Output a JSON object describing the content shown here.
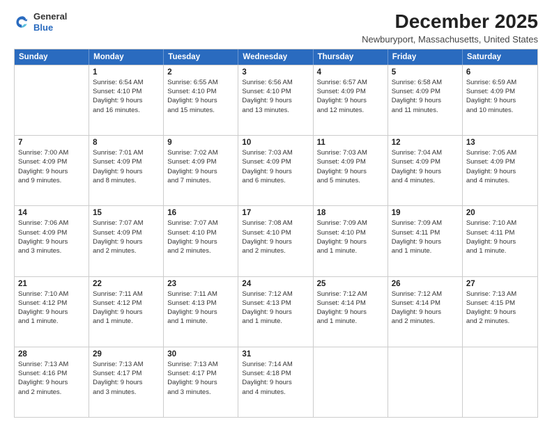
{
  "header": {
    "logo_general": "General",
    "logo_blue": "Blue",
    "month_title": "December 2025",
    "location": "Newburyport, Massachusetts, United States"
  },
  "weekdays": [
    "Sunday",
    "Monday",
    "Tuesday",
    "Wednesday",
    "Thursday",
    "Friday",
    "Saturday"
  ],
  "rows": [
    [
      {
        "day": "",
        "info": ""
      },
      {
        "day": "1",
        "info": "Sunrise: 6:54 AM\nSunset: 4:10 PM\nDaylight: 9 hours\nand 16 minutes."
      },
      {
        "day": "2",
        "info": "Sunrise: 6:55 AM\nSunset: 4:10 PM\nDaylight: 9 hours\nand 15 minutes."
      },
      {
        "day": "3",
        "info": "Sunrise: 6:56 AM\nSunset: 4:10 PM\nDaylight: 9 hours\nand 13 minutes."
      },
      {
        "day": "4",
        "info": "Sunrise: 6:57 AM\nSunset: 4:09 PM\nDaylight: 9 hours\nand 12 minutes."
      },
      {
        "day": "5",
        "info": "Sunrise: 6:58 AM\nSunset: 4:09 PM\nDaylight: 9 hours\nand 11 minutes."
      },
      {
        "day": "6",
        "info": "Sunrise: 6:59 AM\nSunset: 4:09 PM\nDaylight: 9 hours\nand 10 minutes."
      }
    ],
    [
      {
        "day": "7",
        "info": "Sunrise: 7:00 AM\nSunset: 4:09 PM\nDaylight: 9 hours\nand 9 minutes."
      },
      {
        "day": "8",
        "info": "Sunrise: 7:01 AM\nSunset: 4:09 PM\nDaylight: 9 hours\nand 8 minutes."
      },
      {
        "day": "9",
        "info": "Sunrise: 7:02 AM\nSunset: 4:09 PM\nDaylight: 9 hours\nand 7 minutes."
      },
      {
        "day": "10",
        "info": "Sunrise: 7:03 AM\nSunset: 4:09 PM\nDaylight: 9 hours\nand 6 minutes."
      },
      {
        "day": "11",
        "info": "Sunrise: 7:03 AM\nSunset: 4:09 PM\nDaylight: 9 hours\nand 5 minutes."
      },
      {
        "day": "12",
        "info": "Sunrise: 7:04 AM\nSunset: 4:09 PM\nDaylight: 9 hours\nand 4 minutes."
      },
      {
        "day": "13",
        "info": "Sunrise: 7:05 AM\nSunset: 4:09 PM\nDaylight: 9 hours\nand 4 minutes."
      }
    ],
    [
      {
        "day": "14",
        "info": "Sunrise: 7:06 AM\nSunset: 4:09 PM\nDaylight: 9 hours\nand 3 minutes."
      },
      {
        "day": "15",
        "info": "Sunrise: 7:07 AM\nSunset: 4:09 PM\nDaylight: 9 hours\nand 2 minutes."
      },
      {
        "day": "16",
        "info": "Sunrise: 7:07 AM\nSunset: 4:10 PM\nDaylight: 9 hours\nand 2 minutes."
      },
      {
        "day": "17",
        "info": "Sunrise: 7:08 AM\nSunset: 4:10 PM\nDaylight: 9 hours\nand 2 minutes."
      },
      {
        "day": "18",
        "info": "Sunrise: 7:09 AM\nSunset: 4:10 PM\nDaylight: 9 hours\nand 1 minute."
      },
      {
        "day": "19",
        "info": "Sunrise: 7:09 AM\nSunset: 4:11 PM\nDaylight: 9 hours\nand 1 minute."
      },
      {
        "day": "20",
        "info": "Sunrise: 7:10 AM\nSunset: 4:11 PM\nDaylight: 9 hours\nand 1 minute."
      }
    ],
    [
      {
        "day": "21",
        "info": "Sunrise: 7:10 AM\nSunset: 4:12 PM\nDaylight: 9 hours\nand 1 minute."
      },
      {
        "day": "22",
        "info": "Sunrise: 7:11 AM\nSunset: 4:12 PM\nDaylight: 9 hours\nand 1 minute."
      },
      {
        "day": "23",
        "info": "Sunrise: 7:11 AM\nSunset: 4:13 PM\nDaylight: 9 hours\nand 1 minute."
      },
      {
        "day": "24",
        "info": "Sunrise: 7:12 AM\nSunset: 4:13 PM\nDaylight: 9 hours\nand 1 minute."
      },
      {
        "day": "25",
        "info": "Sunrise: 7:12 AM\nSunset: 4:14 PM\nDaylight: 9 hours\nand 1 minute."
      },
      {
        "day": "26",
        "info": "Sunrise: 7:12 AM\nSunset: 4:14 PM\nDaylight: 9 hours\nand 2 minutes."
      },
      {
        "day": "27",
        "info": "Sunrise: 7:13 AM\nSunset: 4:15 PM\nDaylight: 9 hours\nand 2 minutes."
      }
    ],
    [
      {
        "day": "28",
        "info": "Sunrise: 7:13 AM\nSunset: 4:16 PM\nDaylight: 9 hours\nand 2 minutes."
      },
      {
        "day": "29",
        "info": "Sunrise: 7:13 AM\nSunset: 4:17 PM\nDaylight: 9 hours\nand 3 minutes."
      },
      {
        "day": "30",
        "info": "Sunrise: 7:13 AM\nSunset: 4:17 PM\nDaylight: 9 hours\nand 3 minutes."
      },
      {
        "day": "31",
        "info": "Sunrise: 7:14 AM\nSunset: 4:18 PM\nDaylight: 9 hours\nand 4 minutes."
      },
      {
        "day": "",
        "info": ""
      },
      {
        "day": "",
        "info": ""
      },
      {
        "day": "",
        "info": ""
      }
    ]
  ]
}
